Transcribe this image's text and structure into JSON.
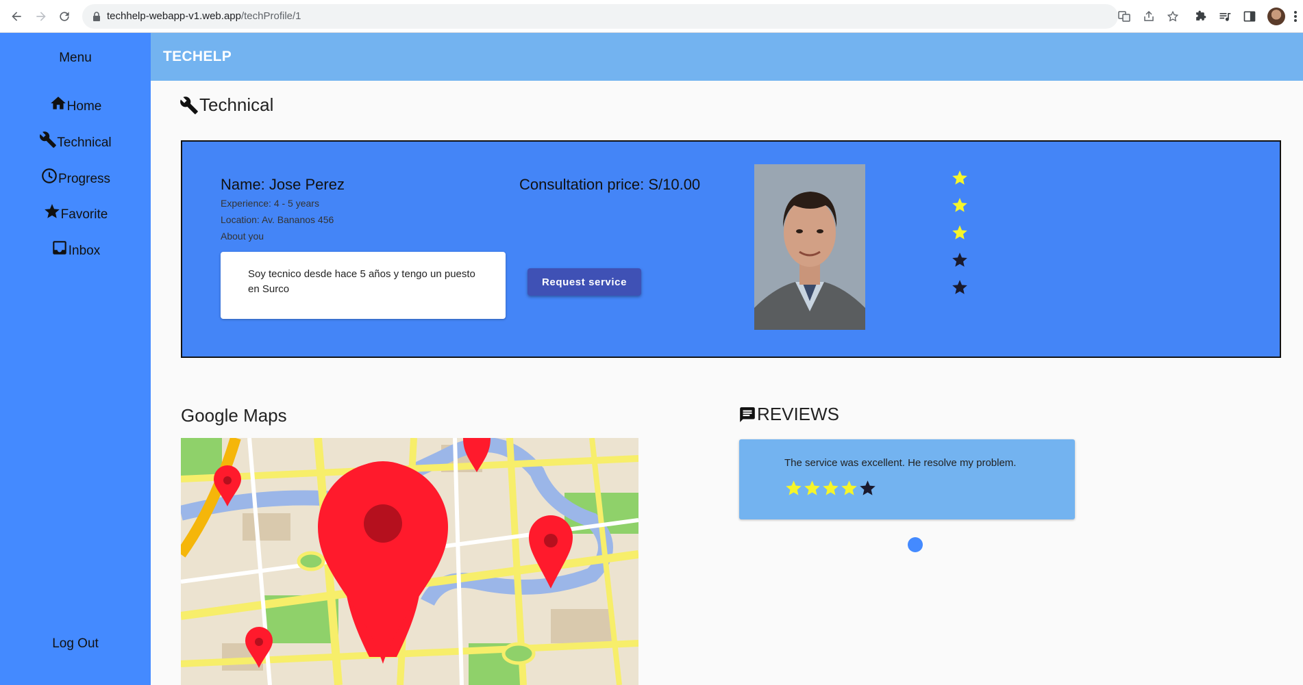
{
  "browser": {
    "url_host": "techhelp-webapp-v1.web.app",
    "url_path": "/techProfile/1"
  },
  "sidebar": {
    "title": "Menu",
    "items": [
      {
        "label": "Home",
        "icon": "home-icon"
      },
      {
        "label": "Technical",
        "icon": "wrench-icon"
      },
      {
        "label": "Progress",
        "icon": "clock-icon"
      },
      {
        "label": "Favorite",
        "icon": "star-icon"
      },
      {
        "label": "Inbox",
        "icon": "inbox-icon"
      }
    ],
    "logout_label": "Log Out"
  },
  "topbar": {
    "brand": "TECHELP"
  },
  "page": {
    "title": "Technical",
    "title_icon": "wrench-icon"
  },
  "profile": {
    "name": "Name: Jose Perez",
    "experience": "Experience: 4 - 5 years",
    "location": "Location: Av. Bananos 456",
    "about_label": "About you",
    "about_text": "Soy tecnico desde hace 5 años y tengo un puesto en Surco",
    "price": "Consultation price: S/10.00",
    "request_button": "Request service",
    "rating": 3,
    "rating_max": 5
  },
  "maps": {
    "title": "Google Maps"
  },
  "reviews": {
    "title": "REVIEWS",
    "title_icon": "comment-icon",
    "items": [
      {
        "text": "The service was excellent. He resolve my problem.",
        "rating": 4,
        "rating_max": 5
      }
    ]
  },
  "colors": {
    "sidebar": "#448aff",
    "topbar": "#73b3f0",
    "card": "#4485f7",
    "button": "#3f51b5",
    "star_filled": "#f5f52a",
    "star_empty": "#1a1a2e"
  }
}
